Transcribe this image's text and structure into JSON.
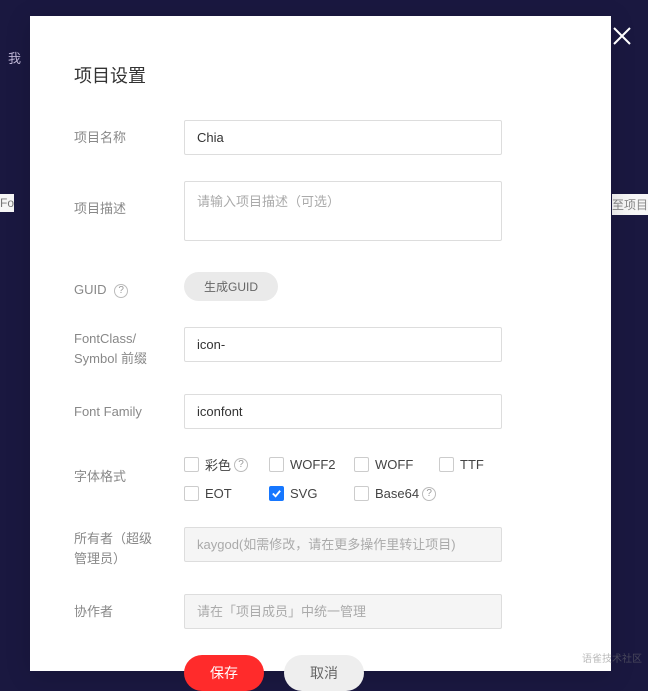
{
  "backdrop": {
    "my": "我"
  },
  "bg": {
    "left": "Fo",
    "right": "至项目"
  },
  "modal": {
    "title": "项目设置",
    "labels": {
      "name": "项目名称",
      "desc": "项目描述",
      "guid": "GUID",
      "prefix_l1": "FontClass/",
      "prefix_l2": "Symbol 前缀",
      "family": "Font Family",
      "format": "字体格式",
      "owner_l1": "所有者（超级",
      "owner_l2": "管理员）",
      "collab": "协作者"
    },
    "values": {
      "name": "Chia",
      "prefix": "icon-",
      "family": "iconfont"
    },
    "placeholders": {
      "desc": "请输入项目描述（可选）",
      "owner": "kaygod(如需修改，请在更多操作里转让项目)",
      "collab": "请在「项目成员」中统一管理"
    },
    "buttons": {
      "guid": "生成GUID",
      "save": "保存",
      "cancel": "取消"
    },
    "formats": {
      "color": "彩色",
      "woff2": "WOFF2",
      "woff": "WOFF",
      "ttf": "TTF",
      "eot": "EOT",
      "svg": "SVG",
      "base64": "Base64"
    },
    "help": "?"
  },
  "watermark": "语雀技术社区"
}
